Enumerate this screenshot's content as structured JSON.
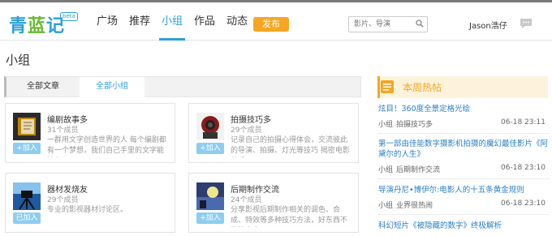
{
  "logo": {
    "part1": "青",
    "part2": "蓝",
    "part3": "记",
    "badge": "beta"
  },
  "nav": {
    "items": [
      "广场",
      "推荐",
      "小组",
      "作品",
      "动态"
    ],
    "active_index": 2,
    "publish": "发布"
  },
  "search": {
    "placeholder": "影片、导演"
  },
  "user": {
    "name": "Jason浩仔"
  },
  "page": {
    "title": "小组"
  },
  "tabs": {
    "articles": "全部文章",
    "groups": "全部小组"
  },
  "groups": [
    {
      "name": "编剧故事多",
      "members": "31个成员",
      "desc": "一群用文字创造世界的人 每个编剧都有一个梦想，我们自己手里的文字能够在",
      "button": "+加入"
    },
    {
      "name": "拍摄技巧多",
      "members": "29个成员",
      "desc": "记录自己的拍摄心得体会，交流彼此的导演、拍摄、灯光等技巧 揭密电影幕后",
      "button": "+加入"
    },
    {
      "name": "器材发烧友",
      "members": "29个成员",
      "desc": "专业的影视器材讨论区。",
      "button": "已加入"
    },
    {
      "name": "后期制作交流",
      "members": "24个成员",
      "desc": "分享影视后期制作相关的调色、合成、特效等多种技巧方法，好东西不能独自享",
      "button": "+加入"
    }
  ],
  "hot": {
    "title": "本周热帖",
    "posts": [
      {
        "title": "炫目！360度全景定格光绘",
        "group_label": "小组",
        "group": "拍摄技巧多",
        "time": "06-18 23:11"
      },
      {
        "title": "第一部由佳能数字摄影机拍摄的魔幻最佳影片《阿黛尔的人生》",
        "group_label": "小组",
        "group": "后期制作交流",
        "time": "06-18 23:10"
      },
      {
        "title": "导演丹尼•博伊尔:电影人的十五条黄金规则",
        "group_label": "小组",
        "group": "业界很热闹",
        "time": "06-18 23:10"
      },
      {
        "title": "科幻短片《被隐藏的数字》终极解析",
        "group_label": "",
        "group": "",
        "time": ""
      }
    ]
  },
  "colors": {
    "accent": "#2a9fd8",
    "logo_green": "#68b92e",
    "publish": "#f6a623",
    "link": "#2a7fc8"
  }
}
